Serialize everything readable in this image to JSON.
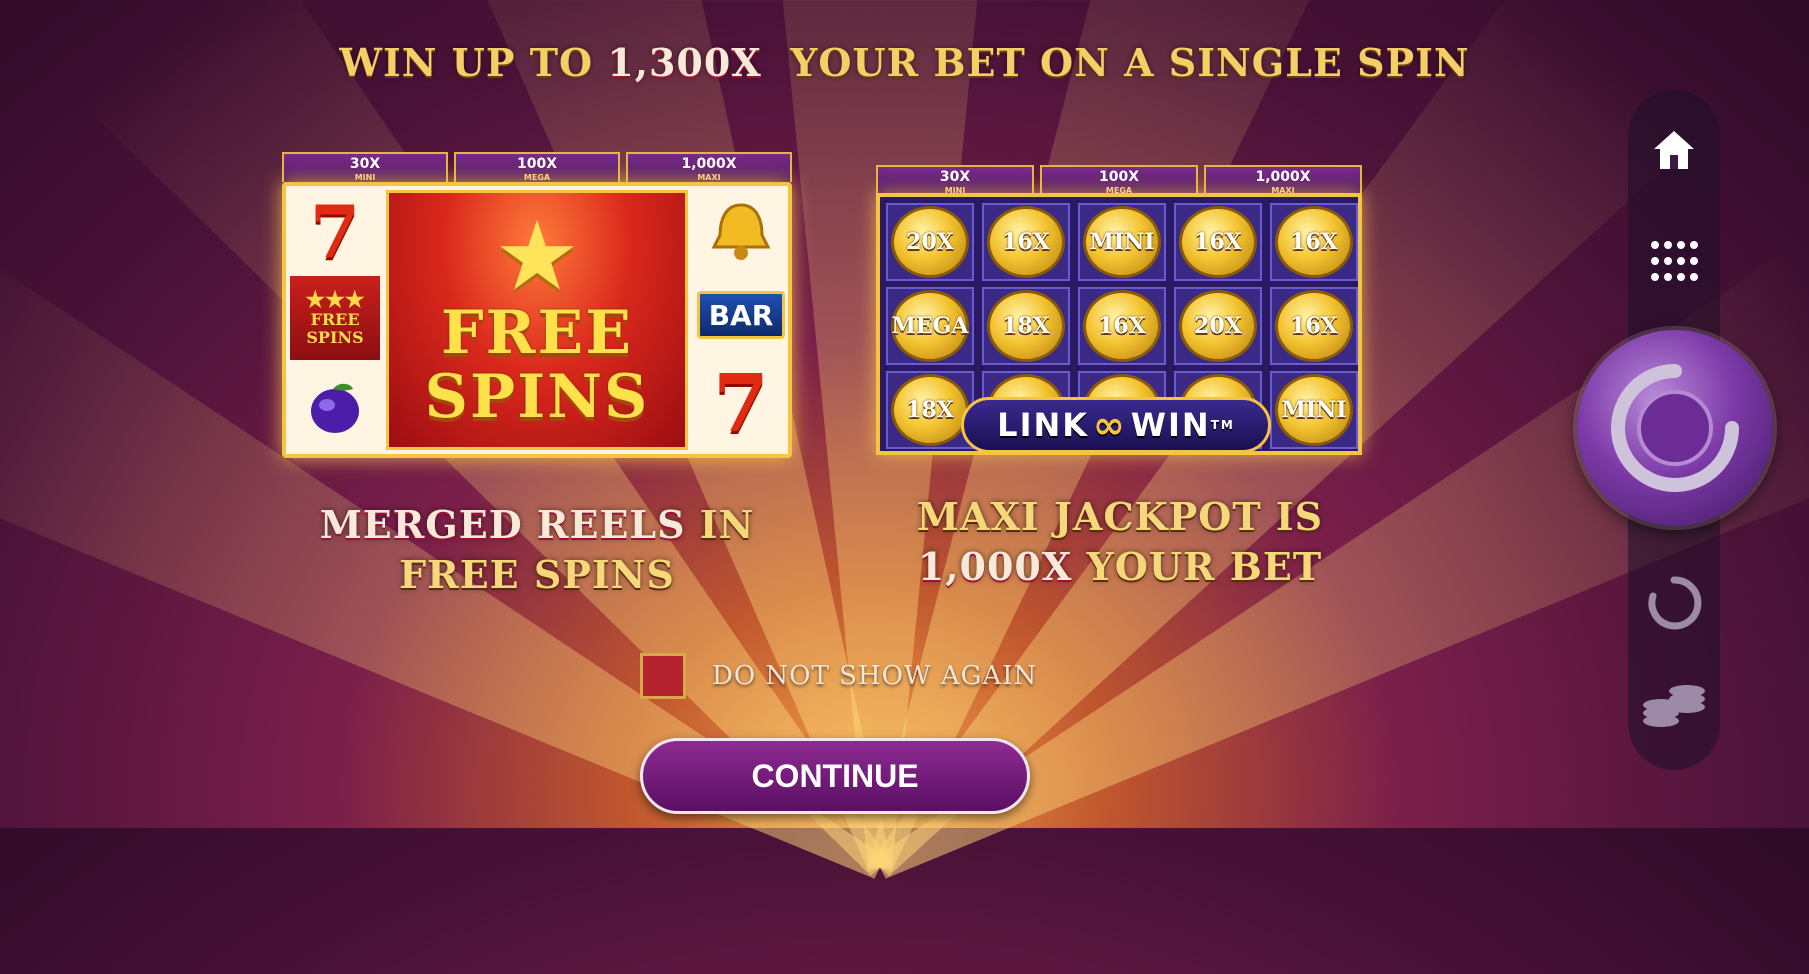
{
  "headline": {
    "pre": "WIN UP TO ",
    "highlight": "1,300X",
    "post": "  YOUR BET ON A SINGLE SPIN"
  },
  "left_panel": {
    "jackpots": [
      {
        "value": "30X",
        "name": "MINI"
      },
      {
        "value": "100X",
        "name": "MEGA"
      },
      {
        "value": "1,000X",
        "name": "MAXI"
      }
    ],
    "small_free_spins": [
      "FREE",
      "SPINS"
    ],
    "big_free_spins": [
      "FREE",
      "SPINS"
    ],
    "seven": "7",
    "bar": "BAR"
  },
  "right_panel": {
    "jackpots": [
      {
        "value": "30X",
        "name": "MINI"
      },
      {
        "value": "100X",
        "name": "MEGA"
      },
      {
        "value": "1,000X",
        "name": "MAXI"
      }
    ],
    "coins": [
      [
        "20X",
        "16X",
        "MINI",
        "16X",
        "16X"
      ],
      [
        "MEGA",
        "18X",
        "16X",
        "20X",
        "16X"
      ],
      [
        "18X",
        "",
        "",
        "",
        "MINI"
      ]
    ],
    "logo": {
      "left": "LINK",
      "right": "WIN",
      "tm": "TM"
    }
  },
  "caption_left": {
    "highlight": "MERGED REELS",
    "rest1": " IN",
    "line2": "FREE SPINS"
  },
  "caption_right": {
    "line1": "MAXI JACKPOT IS",
    "highlight": "1,000X",
    "rest2": " YOUR BET"
  },
  "checkbox": {
    "label": "DO NOT SHOW AGAIN",
    "checked": false
  },
  "continue_button": {
    "label": "CONTINUE"
  },
  "sidebar": {
    "icons": [
      "home-icon",
      "menu-grid-icon",
      "spin-button-icon",
      "autoplay-icon",
      "coins-icon"
    ]
  },
  "colors": {
    "gold": "#f4cf66",
    "highlight": "#f8e9d8",
    "button": "#7a1f80",
    "checkbox": "#b5232e"
  }
}
